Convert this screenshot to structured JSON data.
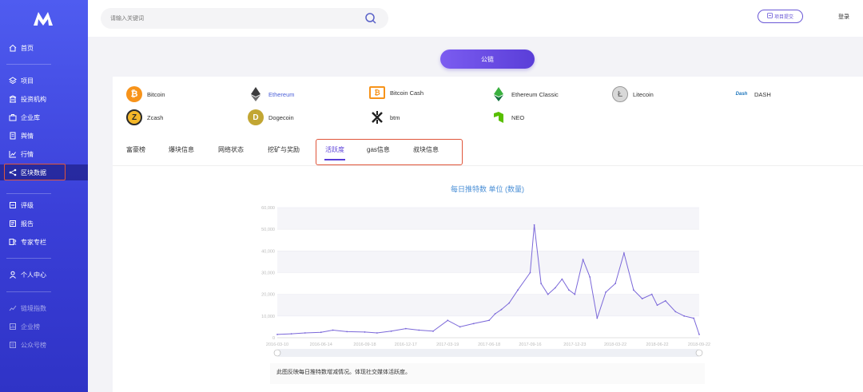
{
  "sidebar": {
    "items": [
      {
        "label": "首页",
        "icon": "home-icon"
      },
      {
        "label": "项目",
        "icon": "layers-icon"
      },
      {
        "label": "投资机构",
        "icon": "building-icon"
      },
      {
        "label": "企业库",
        "icon": "briefcase-icon"
      },
      {
        "label": "舆情",
        "icon": "document-icon"
      },
      {
        "label": "行情",
        "icon": "chart-icon"
      },
      {
        "label": "区块数据",
        "icon": "share-icon"
      },
      {
        "label": "评级",
        "icon": "rating-icon"
      },
      {
        "label": "报告",
        "icon": "report-icon"
      },
      {
        "label": "专家专栏",
        "icon": "expert-icon"
      },
      {
        "label": "个人中心",
        "icon": "user-icon"
      },
      {
        "label": "链境指数",
        "icon": "index-icon"
      },
      {
        "label": "企业榜",
        "icon": "ranking-icon"
      },
      {
        "label": "公众号榜",
        "icon": "wechat-icon"
      }
    ]
  },
  "header": {
    "search_placeholder": "请输入关键词",
    "submit_label": "项目提交",
    "login_label": "登录"
  },
  "chain_button": "公链",
  "coins": [
    {
      "name": "Bitcoin",
      "color": "#f7931a",
      "glyph": "₿"
    },
    {
      "name": "Ethereum",
      "color": "#3c3c3d",
      "glyph": "◆",
      "selected": true
    },
    {
      "name": "Bitcoin Cash",
      "color": "#f7931a",
      "glyph": "[₿]"
    },
    {
      "name": "Ethereum Classic",
      "color": "#328332",
      "glyph": "◆"
    },
    {
      "name": "Litecoin",
      "color": "#b8b8b8",
      "glyph": "Ł"
    },
    {
      "name": "DASH",
      "color": "#1c75bc",
      "glyph": "Dash"
    },
    {
      "name": "Zcash",
      "color": "#2a2a2a",
      "glyph": "Z"
    },
    {
      "name": "Dogecoin",
      "color": "#c2a633",
      "glyph": "D"
    },
    {
      "name": "btm",
      "color": "#222222",
      "glyph": "⟡"
    },
    {
      "name": "NEO",
      "color": "#58bf00",
      "glyph": "N"
    }
  ],
  "tabs": [
    {
      "label": "富豪榜"
    },
    {
      "label": "爆块信息"
    },
    {
      "label": "网络状态"
    },
    {
      "label": "挖矿与奖励"
    },
    {
      "label": "活跃度",
      "active": true
    },
    {
      "label": "gas信息"
    },
    {
      "label": "叔块信息"
    }
  ],
  "chart_data": {
    "type": "line",
    "title": "每日推特数 单位 (数量)",
    "x_tick_labels": [
      "2016-03-10",
      "2016-06-14",
      "2016-09-18",
      "2016-12-17",
      "2017-03-19",
      "2017-06-18",
      "2017-09-16",
      "2017-12-23",
      "2018-03-22",
      "2018-06-22",
      "2018-09-22"
    ],
    "y_tick_labels": [
      "0",
      "10,000",
      "20,000",
      "30,000",
      "40,000",
      "50,000",
      "60,000"
    ],
    "ylim": [
      0,
      60000
    ],
    "series": [
      {
        "color": "#7b68d9",
        "x": [
          "2016-03-10",
          "2016-04-10",
          "2016-05-10",
          "2016-06-14",
          "2016-07-10",
          "2016-08-10",
          "2016-09-18",
          "2016-10-15",
          "2016-11-15",
          "2016-12-17",
          "2017-01-15",
          "2017-02-15",
          "2017-03-19",
          "2017-04-15",
          "2017-05-15",
          "2017-06-18",
          "2017-07-01",
          "2017-07-15",
          "2017-08-01",
          "2017-08-20",
          "2017-09-16",
          "2017-09-25",
          "2017-10-10",
          "2017-10-25",
          "2017-11-10",
          "2017-11-25",
          "2017-12-10",
          "2017-12-23",
          "2018-01-10",
          "2018-01-25",
          "2018-02-10",
          "2018-03-01",
          "2018-03-22",
          "2018-04-10",
          "2018-05-01",
          "2018-05-20",
          "2018-06-10",
          "2018-06-22",
          "2018-07-10",
          "2018-08-01",
          "2018-08-20",
          "2018-09-10",
          "2018-09-22"
        ],
        "y": [
          1500,
          1800,
          2200,
          2500,
          3500,
          2800,
          2600,
          2200,
          3000,
          4200,
          3500,
          3000,
          8000,
          5000,
          6500,
          8000,
          11000,
          13000,
          16000,
          22000,
          30000,
          52000,
          25000,
          20000,
          23000,
          27000,
          22000,
          20000,
          36000,
          28000,
          9000,
          21000,
          25000,
          39000,
          22000,
          18000,
          20000,
          15000,
          17000,
          12000,
          10000,
          9000,
          1500
        ]
      }
    ]
  },
  "caption": "此图反映每日推特数增减情况。体现社交媒体活跃度。",
  "colors": {
    "sidebar": "#4f5cf0",
    "accent": "#5a3ed8",
    "highlight_outline": "#e0553a",
    "chart_line": "#7b68d9"
  }
}
